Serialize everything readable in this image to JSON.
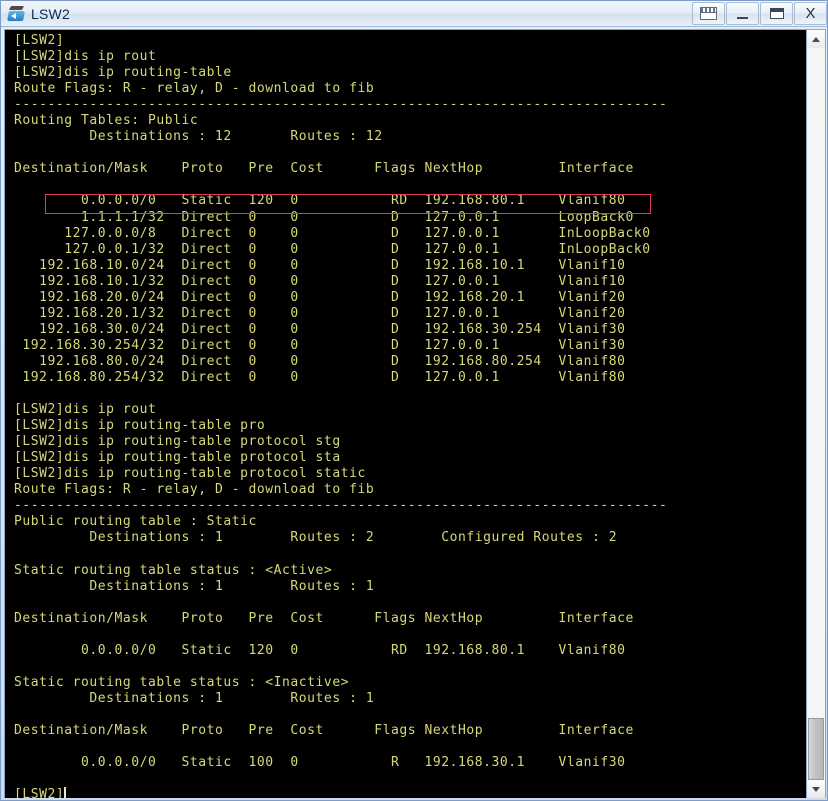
{
  "window": {
    "title": "LSW2",
    "icon": "switch-icon",
    "colors": {
      "terminal_bg": "#000000",
      "terminal_fg": "#d7d77a",
      "highlight_border": "#e03a54",
      "title_text": "#0d2b4e"
    }
  },
  "titlebar_buttons": [
    {
      "name": "window-list-button",
      "label": ""
    },
    {
      "name": "minimize-button",
      "label": ""
    },
    {
      "name": "maximize-button",
      "label": ""
    },
    {
      "name": "close-button",
      "label": "X"
    }
  ],
  "scrollbar": {
    "up_arrow": "∧",
    "down_arrow": "∨"
  },
  "terminal": {
    "prompt": "[LSW2]",
    "lines": [
      "[LSW2]",
      "[LSW2]dis ip rout",
      "[LSW2]dis ip routing-table",
      "Route Flags: R - relay, D - download to fib",
      "------------------------------------------------------------------------------",
      "Routing Tables: Public",
      "         Destinations : 12       Routes : 12",
      "",
      "Destination/Mask    Proto   Pre  Cost      Flags NextHop         Interface",
      "",
      "        0.0.0.0/0   Static  120  0           RD  192.168.80.1    Vlanif80",
      "        1.1.1.1/32  Direct  0    0           D   127.0.0.1       LoopBack0",
      "      127.0.0.0/8   Direct  0    0           D   127.0.0.1       InLoopBack0",
      "      127.0.0.1/32  Direct  0    0           D   127.0.0.1       InLoopBack0",
      "   192.168.10.0/24  Direct  0    0           D   192.168.10.1    Vlanif10",
      "   192.168.10.1/32  Direct  0    0           D   127.0.0.1       Vlanif10",
      "   192.168.20.0/24  Direct  0    0           D   192.168.20.1    Vlanif20",
      "   192.168.20.1/32  Direct  0    0           D   127.0.0.1       Vlanif20",
      "   192.168.30.0/24  Direct  0    0           D   192.168.30.254  Vlanif30",
      " 192.168.30.254/32  Direct  0    0           D   127.0.0.1       Vlanif30",
      "   192.168.80.0/24  Direct  0    0           D   192.168.80.254  Vlanif80",
      " 192.168.80.254/32  Direct  0    0           D   127.0.0.1       Vlanif80",
      "",
      "[LSW2]dis ip rout",
      "[LSW2]dis ip routing-table pro",
      "[LSW2]dis ip routing-table protocol stg",
      "[LSW2]dis ip routing-table protocol sta",
      "[LSW2]dis ip routing-table protocol static",
      "Route Flags: R - relay, D - download to fib",
      "------------------------------------------------------------------------------",
      "Public routing table : Static",
      "         Destinations : 1        Routes : 2        Configured Routes : 2",
      "",
      "Static routing table status : <Active>",
      "         Destinations : 1        Routes : 1",
      "",
      "Destination/Mask    Proto   Pre  Cost      Flags NextHop         Interface",
      "",
      "        0.0.0.0/0   Static  120  0           RD  192.168.80.1    Vlanif80",
      "",
      "Static routing table status : <Inactive>",
      "         Destinations : 1        Routes : 1",
      "",
      "Destination/Mask    Proto   Pre  Cost      Flags NextHop         Interface",
      "",
      "        0.0.0.0/0   Static  100  0           R   192.168.30.1    Vlanif30",
      ""
    ],
    "last_prompt": "[LSW2]",
    "highlight": {
      "target_line_index": 10,
      "label": "default-static-route-highlight"
    }
  },
  "chart_data": {
    "type": "table",
    "title": "IP routing-table (Public) - LSW2",
    "columns": [
      "Destination/Mask",
      "Proto",
      "Pre",
      "Cost",
      "Flags",
      "NextHop",
      "Interface"
    ],
    "summary": {
      "destinations": 12,
      "routes": 12
    },
    "rows": [
      [
        "0.0.0.0/0",
        "Static",
        "120",
        "0",
        "RD",
        "192.168.80.1",
        "Vlanif80"
      ],
      [
        "1.1.1.1/32",
        "Direct",
        "0",
        "0",
        "D",
        "127.0.0.1",
        "LoopBack0"
      ],
      [
        "127.0.0.0/8",
        "Direct",
        "0",
        "0",
        "D",
        "127.0.0.1",
        "InLoopBack0"
      ],
      [
        "127.0.0.1/32",
        "Direct",
        "0",
        "0",
        "D",
        "127.0.0.1",
        "InLoopBack0"
      ],
      [
        "192.168.10.0/24",
        "Direct",
        "0",
        "0",
        "D",
        "192.168.10.1",
        "Vlanif10"
      ],
      [
        "192.168.10.1/32",
        "Direct",
        "0",
        "0",
        "D",
        "127.0.0.1",
        "Vlanif10"
      ],
      [
        "192.168.20.0/24",
        "Direct",
        "0",
        "0",
        "D",
        "192.168.20.1",
        "Vlanif20"
      ],
      [
        "192.168.20.1/32",
        "Direct",
        "0",
        "0",
        "D",
        "127.0.0.1",
        "Vlanif20"
      ],
      [
        "192.168.30.0/24",
        "Direct",
        "0",
        "0",
        "D",
        "192.168.30.254",
        "Vlanif30"
      ],
      [
        "192.168.30.254/32",
        "Direct",
        "0",
        "0",
        "D",
        "127.0.0.1",
        "Vlanif30"
      ],
      [
        "192.168.80.0/24",
        "Direct",
        "0",
        "0",
        "D",
        "192.168.80.254",
        "Vlanif80"
      ],
      [
        "192.168.80.254/32",
        "Direct",
        "0",
        "0",
        "D",
        "127.0.0.1",
        "Vlanif80"
      ]
    ],
    "static_active": {
      "status": "<Active>",
      "destinations": 1,
      "routes": 1,
      "rows": [
        [
          "0.0.0.0/0",
          "Static",
          "120",
          "0",
          "RD",
          "192.168.80.1",
          "Vlanif80"
        ]
      ]
    },
    "static_inactive": {
      "status": "<Inactive>",
      "destinations": 1,
      "routes": 1,
      "rows": [
        [
          "0.0.0.0/0",
          "Static",
          "100",
          "0",
          "R",
          "192.168.30.1",
          "Vlanif30"
        ]
      ]
    }
  }
}
